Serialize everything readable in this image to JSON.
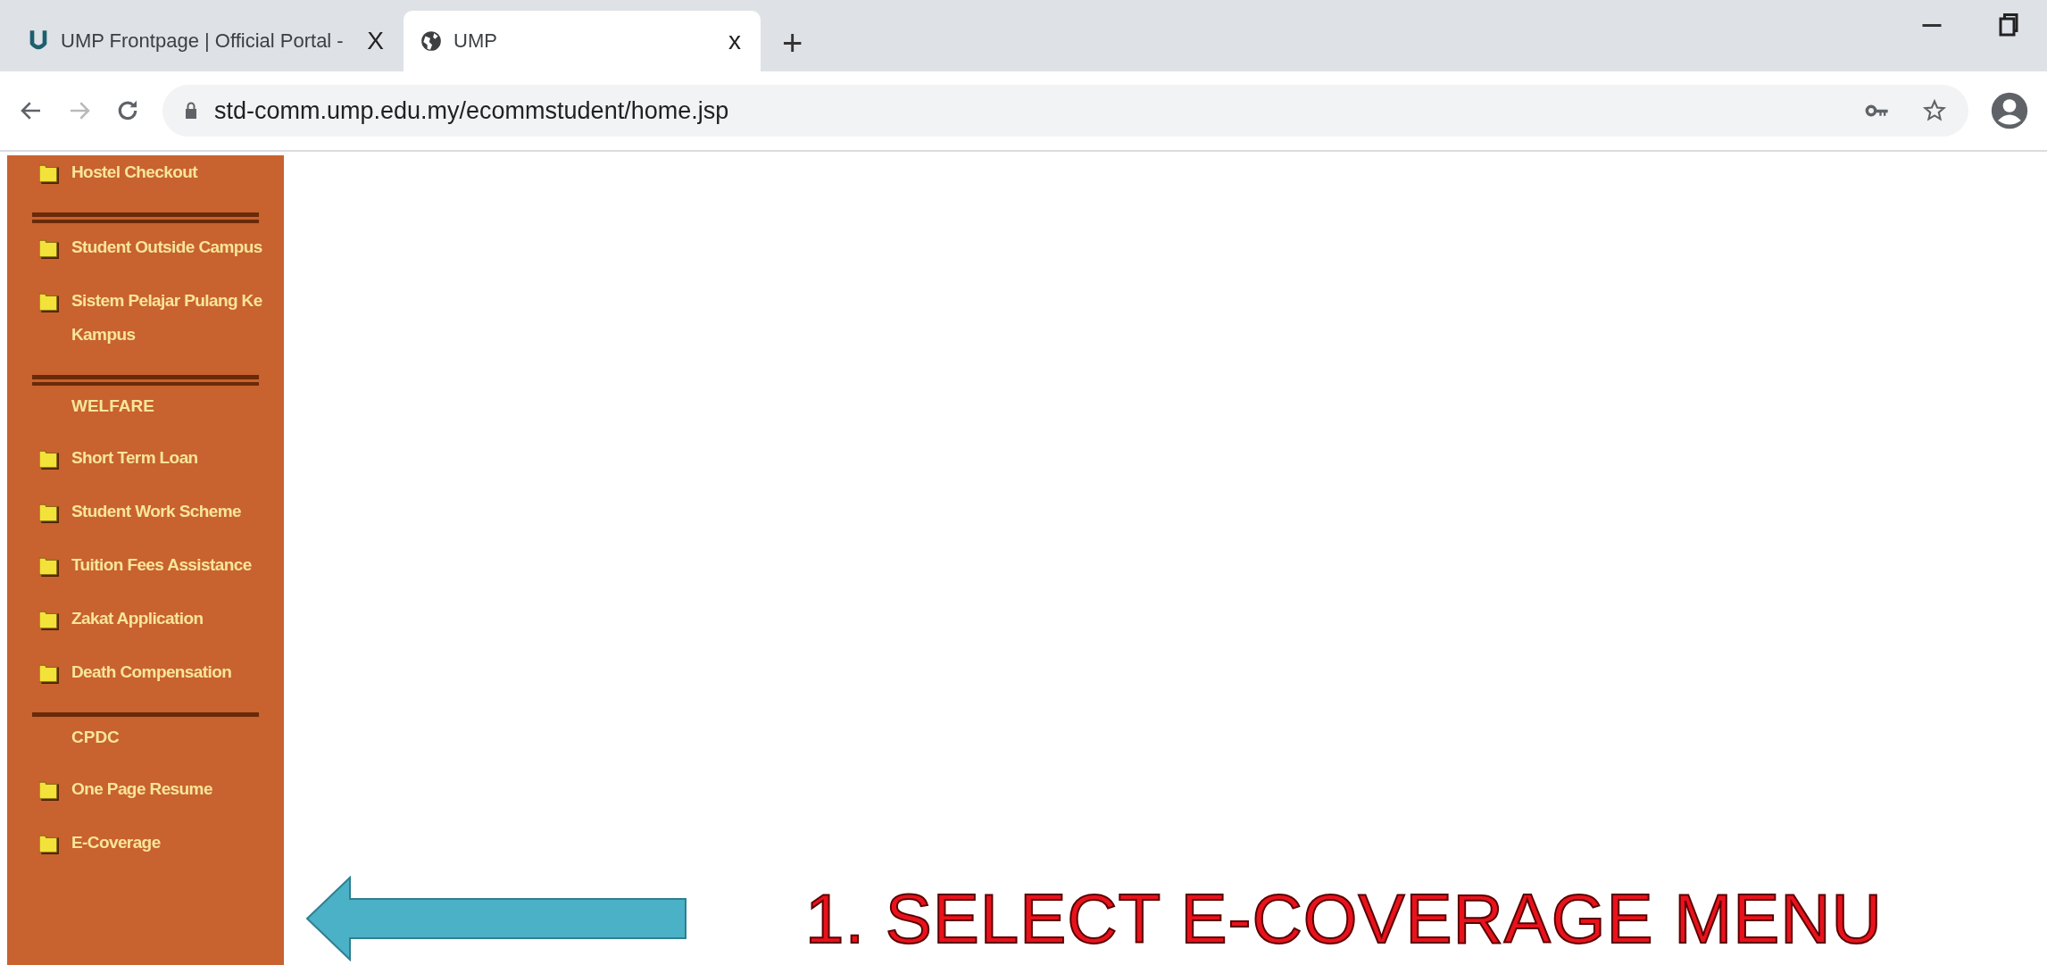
{
  "tabs": [
    {
      "title": "UMP Frontpage | Official Portal -",
      "close": "X",
      "selected": false
    },
    {
      "title": "UMP",
      "close": "x",
      "selected": true
    }
  ],
  "new_tab": "+",
  "address_bar": {
    "url": "std-comm.ump.edu.my/ecommstudent/home.jsp"
  },
  "sidebar": {
    "items": [
      {
        "kind": "link",
        "label": "Hostel Checkout"
      },
      {
        "kind": "double-rule"
      },
      {
        "kind": "link",
        "label": "Student Outside Campus"
      },
      {
        "kind": "link",
        "label": "Sistem Pelajar Pulang Ke Kampus"
      },
      {
        "kind": "double-rule"
      },
      {
        "kind": "heading",
        "label": "WELFARE"
      },
      {
        "kind": "link",
        "label": "Short Term Loan"
      },
      {
        "kind": "link",
        "label": "Student Work Scheme"
      },
      {
        "kind": "link",
        "label": "Tuition Fees Assistance"
      },
      {
        "kind": "link",
        "label": "Zakat Application"
      },
      {
        "kind": "link",
        "label": "Death Compensation"
      },
      {
        "kind": "rule"
      },
      {
        "kind": "heading",
        "label": "CPDC"
      },
      {
        "kind": "link",
        "label": "One Page Resume"
      },
      {
        "kind": "link",
        "label": "E-Coverage"
      }
    ]
  },
  "annotation": {
    "caption": "1. SELECT E-COVERAGE MENU"
  }
}
